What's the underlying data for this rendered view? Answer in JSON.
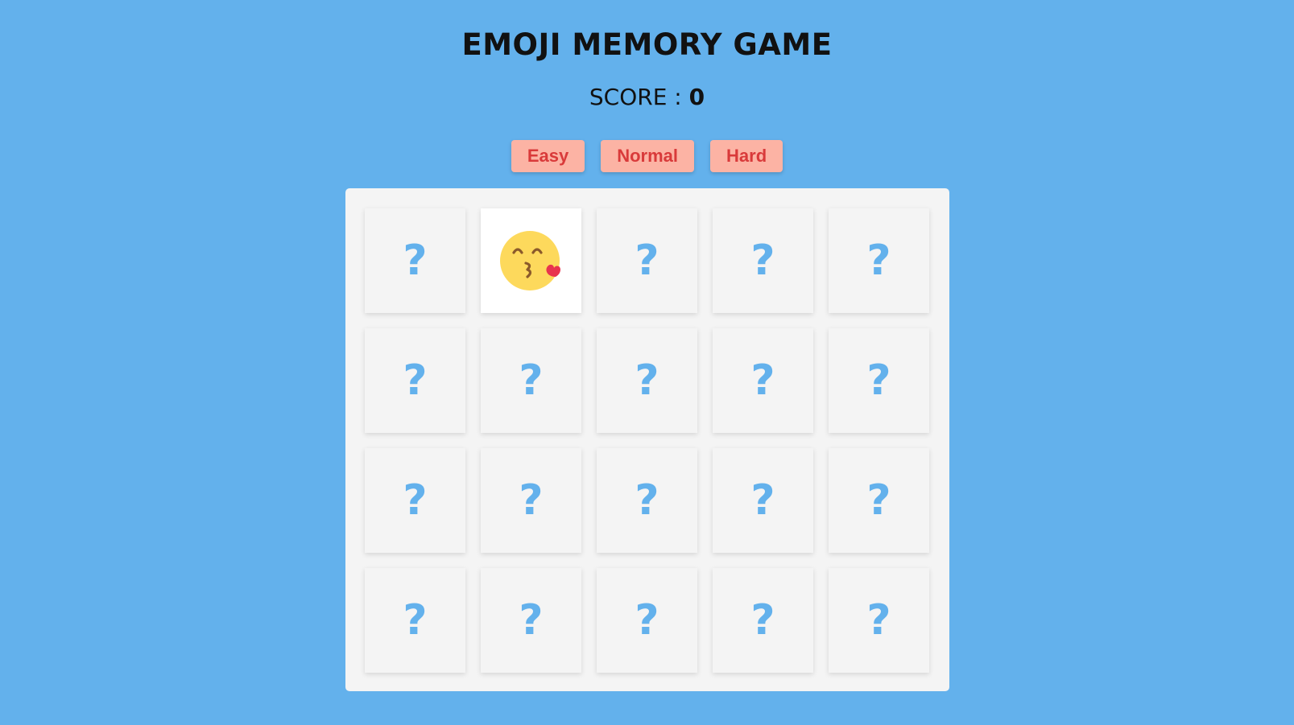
{
  "title": "EMOJI MEMORY GAME",
  "score": {
    "label": "SCORE : ",
    "value": "0"
  },
  "levels": [
    {
      "label": "Easy"
    },
    {
      "label": "Normal"
    },
    {
      "label": "Hard"
    }
  ],
  "board": {
    "rows": 4,
    "columns": 5,
    "hidden_symbol": "?",
    "cards": [
      {
        "state": "hidden",
        "text": "?"
      },
      {
        "state": "revealed",
        "icon": "kissing-face-with-heart-icon"
      },
      {
        "state": "hidden",
        "text": "?"
      },
      {
        "state": "hidden",
        "text": "?"
      },
      {
        "state": "hidden",
        "text": "?"
      },
      {
        "state": "hidden",
        "text": "?"
      },
      {
        "state": "hidden",
        "text": "?"
      },
      {
        "state": "hidden",
        "text": "?"
      },
      {
        "state": "hidden",
        "text": "?"
      },
      {
        "state": "hidden",
        "text": "?"
      },
      {
        "state": "hidden",
        "text": "?"
      },
      {
        "state": "hidden",
        "text": "?"
      },
      {
        "state": "hidden",
        "text": "?"
      },
      {
        "state": "hidden",
        "text": "?"
      },
      {
        "state": "hidden",
        "text": "?"
      },
      {
        "state": "hidden",
        "text": "?"
      },
      {
        "state": "hidden",
        "text": "?"
      },
      {
        "state": "hidden",
        "text": "?"
      },
      {
        "state": "hidden",
        "text": "?"
      },
      {
        "state": "hidden",
        "text": "?"
      }
    ]
  },
  "colors": {
    "background": "#63b1ec",
    "board": "#f4f4f4",
    "button_bg": "#fcb3a4",
    "button_text": "#d93a3a",
    "question_mark": "#63b1ec"
  }
}
